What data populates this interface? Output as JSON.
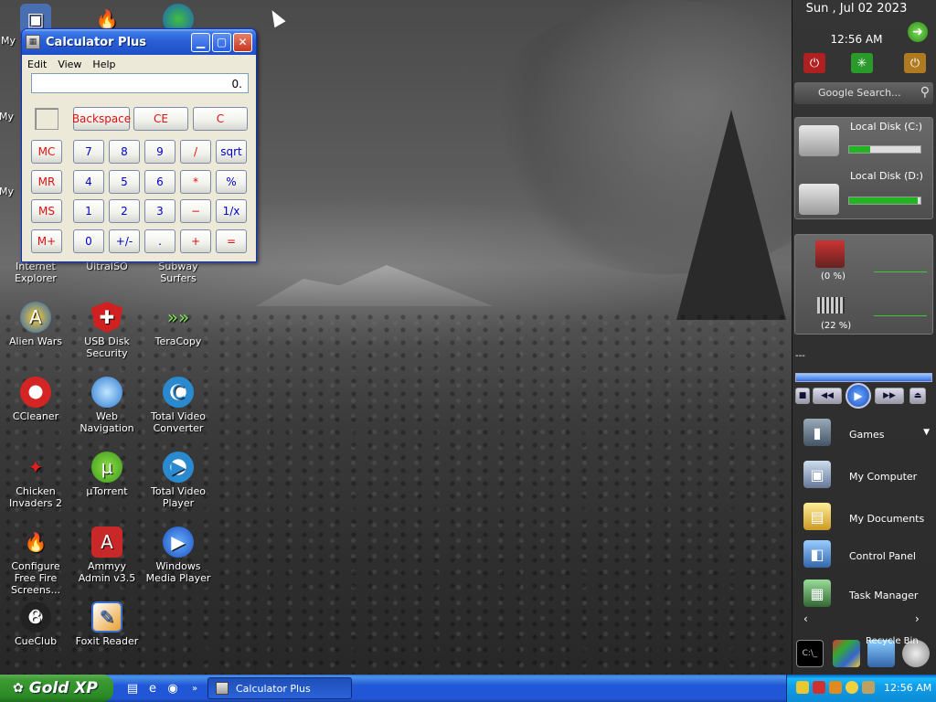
{
  "desktop": {
    "icons": [
      {
        "label": "My",
        "icon": "computer-icon"
      },
      {
        "label": "My",
        "icon": "documents-icon"
      },
      {
        "label": "My",
        "icon": "network-icon"
      },
      {
        "label": "Internet Explorer",
        "icon": "ie-icon"
      },
      {
        "label": "UltraISO",
        "icon": "ultraiso-icon"
      },
      {
        "label": "Subway Surfers",
        "icon": "subway-icon"
      },
      {
        "label": "Alien Wars",
        "icon": "alien-wars-icon"
      },
      {
        "label": "USB Disk Security",
        "icon": "usb-shield-icon"
      },
      {
        "label": "TeraCopy",
        "icon": "teracopy-icon"
      },
      {
        "label": "CCleaner",
        "icon": "ccleaner-icon"
      },
      {
        "label": "Web Navigation",
        "icon": "globe-icon"
      },
      {
        "label": "Total Video Converter",
        "icon": "converter-icon"
      },
      {
        "label": "Chicken Invaders 2",
        "icon": "chicken-icon"
      },
      {
        "label": "µTorrent",
        "icon": "utorrent-icon"
      },
      {
        "label": "Total Video Player",
        "icon": "video-player-icon"
      },
      {
        "label": "Configure Free Fire Screens...",
        "icon": "fire-icon"
      },
      {
        "label": "Ammyy Admin v3.5",
        "icon": "ammyy-icon"
      },
      {
        "label": "Windows Media Player",
        "icon": "wmp-icon"
      },
      {
        "label": "CueClub",
        "icon": "cueclub-icon"
      },
      {
        "label": "Foxit Reader",
        "icon": "foxit-icon"
      }
    ]
  },
  "calculator": {
    "title": "Calculator Plus",
    "menu": [
      "Edit",
      "View",
      "Help"
    ],
    "display": "0.",
    "buttons": {
      "backspace": "Backspace",
      "ce": "CE",
      "c": "C",
      "mc": "MC",
      "mr": "MR",
      "ms": "MS",
      "mplus": "M+",
      "n7": "7",
      "n8": "8",
      "n9": "9",
      "div": "/",
      "sqrt": "sqrt",
      "n4": "4",
      "n5": "5",
      "n6": "6",
      "mul": "*",
      "pct": "%",
      "n1": "1",
      "n2": "2",
      "n3": "3",
      "sub": "−",
      "inv": "1/x",
      "n0": "0",
      "sign": "+/-",
      "dot": ".",
      "add": "+",
      "eq": "="
    }
  },
  "sidebar": {
    "date": "Sun , Jul 02 2023",
    "time": "12:56 AM",
    "search_placeholder": "Google Search...",
    "disks": [
      {
        "label": "Local Disk (C:)",
        "used": 0.3
      },
      {
        "label": "Local Disk (D:)",
        "used": 0.96
      }
    ],
    "cpu": "(0 %)",
    "ram": "(22 %)",
    "media_track": "---",
    "links": [
      "Games",
      "My Computer",
      "My Documents",
      "Control Panel",
      "Task Manager"
    ],
    "recycle_bin": "Recycle Bin"
  },
  "taskbar": {
    "start_label": "Gold XP",
    "task_window": "Calculator Plus",
    "clock": "12:56 AM"
  }
}
